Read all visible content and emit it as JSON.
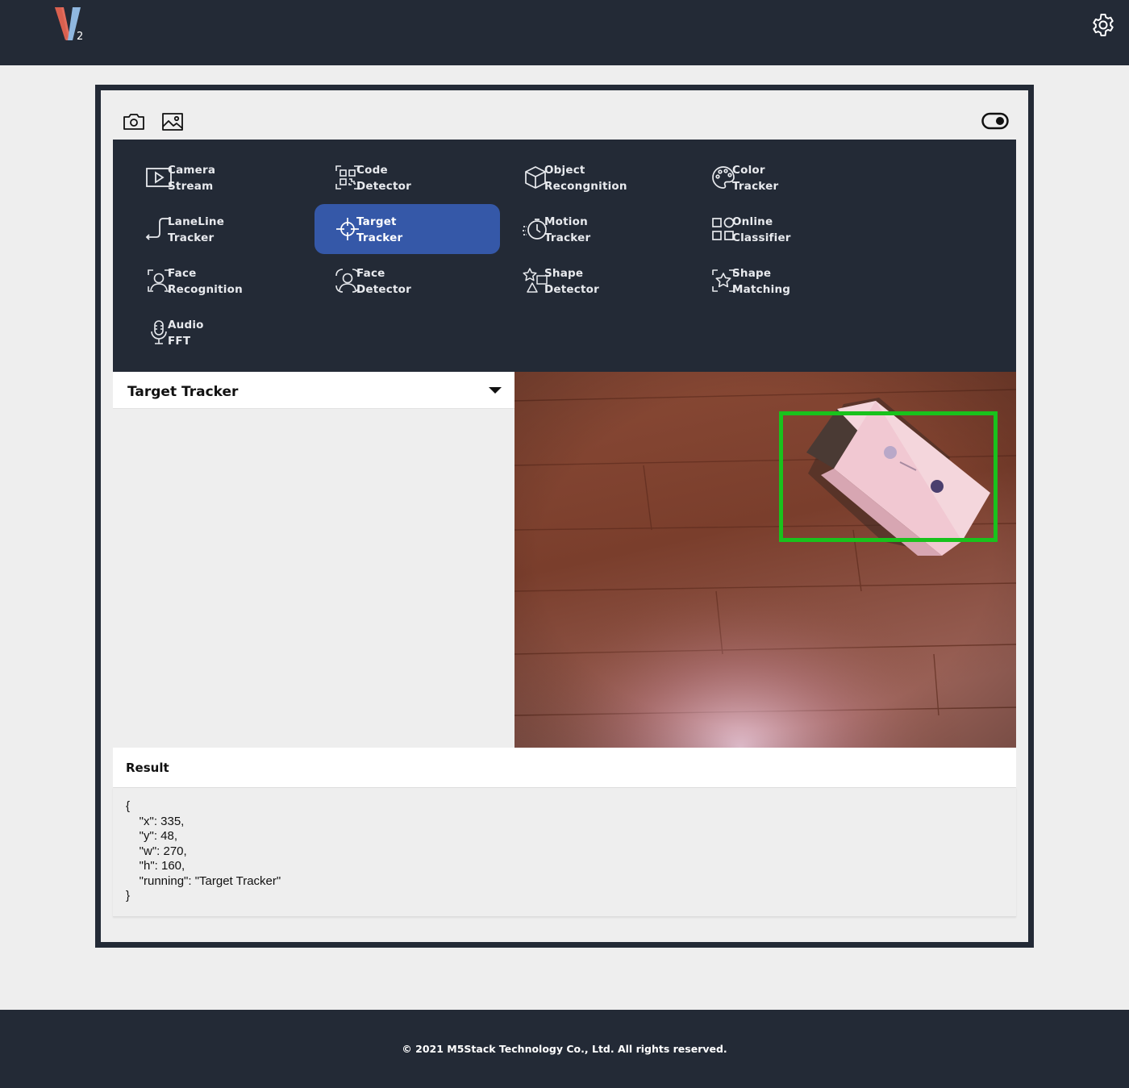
{
  "header": {
    "logo_letter": "V",
    "logo_sub": "2",
    "settings_icon": "gear-icon"
  },
  "toolbar": {
    "capture_icon": "camera-icon",
    "gallery_icon": "image-icon",
    "toggle_icon": "toggle-switch-icon"
  },
  "menu": {
    "items": [
      {
        "line1": "Camera",
        "line2": "Stream",
        "icon": "play-box-icon",
        "active": false
      },
      {
        "line1": "Code",
        "line2": "Detector",
        "icon": "qr-code-icon",
        "active": false
      },
      {
        "line1": "Object",
        "line2": "Recongnition",
        "icon": "cube-icon",
        "active": false
      },
      {
        "line1": "Color",
        "line2": "Tracker",
        "icon": "palette-icon",
        "active": false
      },
      {
        "line1": "LaneLine",
        "line2": "Tracker",
        "icon": "step-line-icon",
        "active": false
      },
      {
        "line1": "Target",
        "line2": "Tracker",
        "icon": "crosshair-icon",
        "active": true
      },
      {
        "line1": "Motion",
        "line2": "Tracker",
        "icon": "motion-timer-icon",
        "active": false
      },
      {
        "line1": "Online",
        "line2": "Classifier",
        "icon": "grid-shapes-icon",
        "active": false
      },
      {
        "line1": "Face",
        "line2": "Recognition",
        "icon": "face-scan-icon",
        "active": false
      },
      {
        "line1": "Face",
        "line2": "Detector",
        "icon": "face-frame-icon",
        "active": false
      },
      {
        "line1": "Shape",
        "line2": "Detector",
        "icon": "shapes-icon",
        "active": false
      },
      {
        "line1": "Shape",
        "line2": "Matching",
        "icon": "star-frame-icon",
        "active": false
      },
      {
        "line1": "Audio",
        "line2": "FFT",
        "icon": "microphone-icon",
        "active": false
      }
    ]
  },
  "function_select": {
    "label": "Target Tracker"
  },
  "result": {
    "title": "Result",
    "json_lines": [
      "{",
      "    \"x\": 335,",
      "    \"y\": 48,",
      "    \"w\": 270,",
      "    \"h\": 160,",
      "    \"running\": \"Target Tracker\"",
      "}"
    ]
  },
  "colors": {
    "dark": "#232a36",
    "active": "#3558a8",
    "detection_box": "#19c21c"
  },
  "footer": {
    "copyright": "© 2021 M5Stack Technology Co., Ltd. All rights reserved."
  }
}
